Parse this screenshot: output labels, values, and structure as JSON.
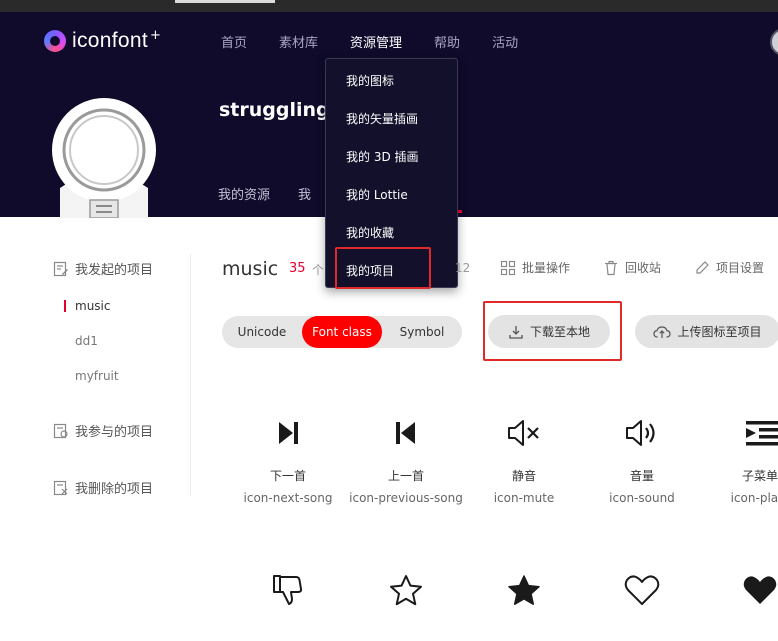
{
  "brand": {
    "logo_text": "iconfont",
    "logo_plus": "+"
  },
  "nav": {
    "items": [
      "首页",
      "素材库",
      "资源管理",
      "帮助",
      "活动"
    ],
    "active": "资源管理"
  },
  "user": {
    "name": "strugglingle"
  },
  "tabs": [
    "我的资源",
    "我"
  ],
  "dropdown": [
    "我的图标",
    "我的矢量插画",
    "我的 3D 插画",
    "我的 Lottie",
    "我的收藏",
    "我的项目"
  ],
  "sidebar": {
    "group_started": "我发起的项目",
    "projects": [
      "music",
      "dd1",
      "myfruit"
    ],
    "group_joined": "我参与的项目",
    "group_deleted": "我删除的项目"
  },
  "project": {
    "title": "music",
    "count": "35",
    "count_unit": "个",
    "hidden_text": "12",
    "actions": [
      "批量操作",
      "回收站",
      "项目设置"
    ]
  },
  "format_tabs": {
    "options": [
      "Unicode",
      "Font class",
      "Symbol"
    ],
    "active": "Font class"
  },
  "buttons": {
    "download": "下载至本地",
    "upload": "上传图标至项目"
  },
  "icons": [
    {
      "cn": "下一首",
      "en": "icon-next-song",
      "icon": "next-song-icon"
    },
    {
      "cn": "上一首",
      "en": "icon-previous-song",
      "icon": "previous-song-icon"
    },
    {
      "cn": "静音",
      "en": "icon-mute",
      "icon": "mute-icon"
    },
    {
      "cn": "音量",
      "en": "icon-sound",
      "icon": "sound-icon"
    },
    {
      "cn": "子菜单",
      "en": "icon-play-",
      "icon": "submenu-icon"
    },
    {
      "cn": "",
      "en": "",
      "icon": "thumbs-down-icon"
    },
    {
      "cn": "",
      "en": "",
      "icon": "star-outline-icon"
    },
    {
      "cn": "",
      "en": "",
      "icon": "star-filled-icon"
    },
    {
      "cn": "",
      "en": "",
      "icon": "heart-outline-icon"
    },
    {
      "cn": "",
      "en": "",
      "icon": "heart-filled-icon"
    }
  ],
  "colors": {
    "header_bg": "#100a2b",
    "accent_red": "#ff0000",
    "highlight_box": "#e02a2a",
    "active_bar": "#e6002d"
  }
}
